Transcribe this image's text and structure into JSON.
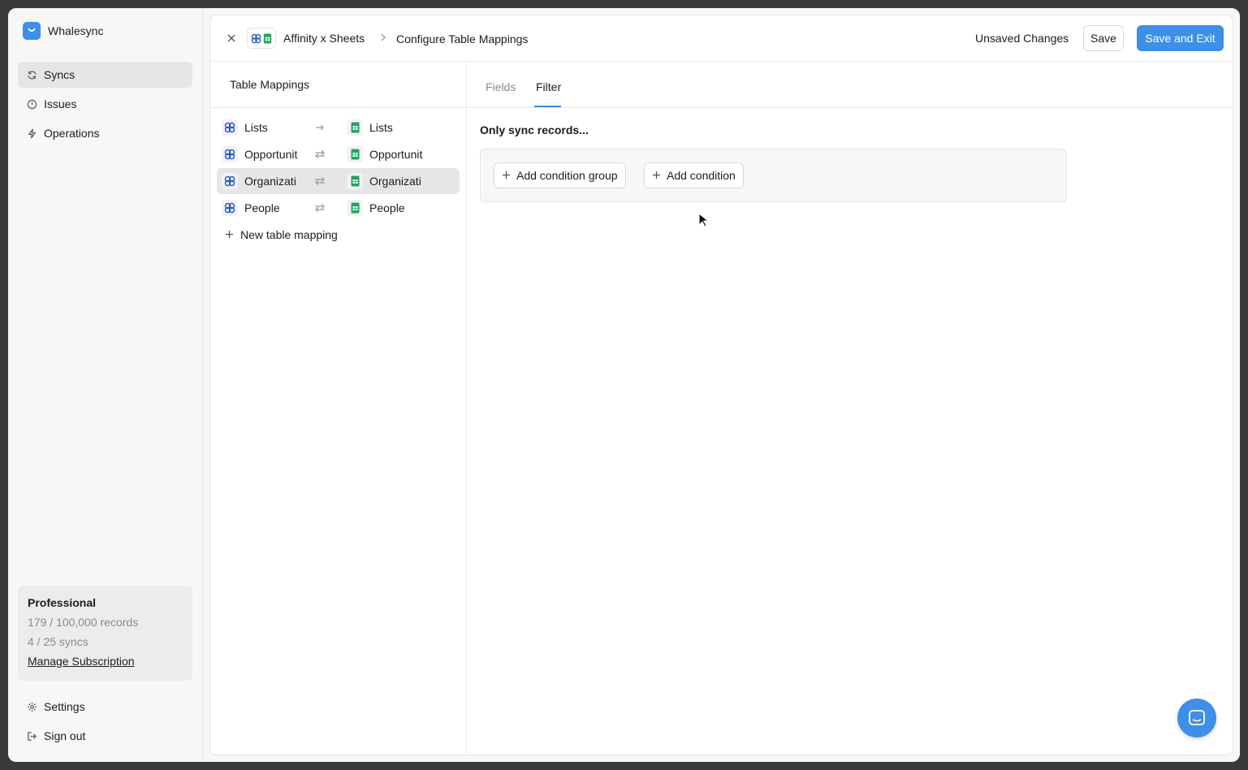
{
  "app": {
    "name": "Whalesync",
    "brand_color": "#3d8fe8"
  },
  "sidebar": {
    "items": [
      {
        "label": "Syncs",
        "icon": "refresh-icon",
        "active": true
      },
      {
        "label": "Issues",
        "icon": "alert-circle-icon",
        "active": false
      },
      {
        "label": "Operations",
        "icon": "lightning-icon",
        "active": false
      }
    ],
    "plan": {
      "name": "Professional",
      "records": "179 / 100,000 records",
      "syncs": "4 / 25 syncs",
      "manage_label": "Manage Subscription"
    },
    "bottom_items": [
      {
        "label": "Settings",
        "icon": "gear-icon"
      },
      {
        "label": "Sign out",
        "icon": "sign-out-icon"
      }
    ]
  },
  "header": {
    "sync_name": "Affinity x Sheets",
    "page_title": "Configure Table Mappings",
    "status": "Unsaved Changes",
    "save_label": "Save",
    "save_exit_label": "Save and Exit"
  },
  "mappings": {
    "title": "Table Mappings",
    "rows": [
      {
        "left": "Lists",
        "right": "Lists",
        "direction": "one-way",
        "active": false
      },
      {
        "left": "Opportunit",
        "right": "Opportunit",
        "direction": "two-way",
        "active": false
      },
      {
        "left": "Organizati",
        "right": "Organizati",
        "direction": "two-way",
        "active": true
      },
      {
        "left": "People",
        "right": "People",
        "direction": "two-way",
        "active": false
      }
    ],
    "new_label": "New table mapping"
  },
  "tabs": [
    {
      "label": "Fields",
      "active": false
    },
    {
      "label": "Filter",
      "active": true
    }
  ],
  "filter": {
    "heading": "Only sync records...",
    "add_group_label": "Add condition group",
    "add_condition_label": "Add condition"
  }
}
